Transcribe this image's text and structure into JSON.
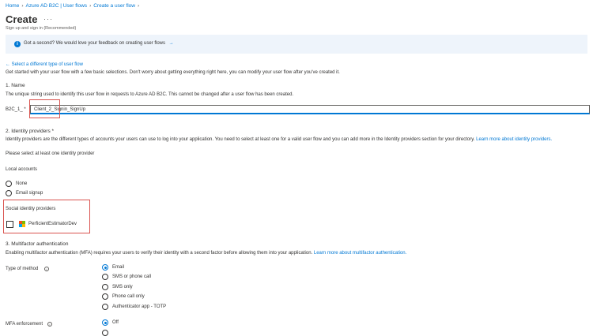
{
  "breadcrumb": [
    "Home",
    "Azure AD B2C | User flows",
    "Create a user flow"
  ],
  "page": {
    "title": "Create",
    "subtitle": "Sign up and sign in (Recommended)"
  },
  "feedback": {
    "text": "Got a second? We would love your feedback on creating user flows",
    "arrow": "→"
  },
  "back_link": "Select a different type of user flow",
  "intro": "Get started with your user flow with a few basic selections. Don't worry about getting everything right here, you can modify your user flow after you've created it.",
  "name_section": {
    "heading": "1. Name",
    "description": "The unique string used to identify this user flow in requests to Azure AD B2C. This cannot be changed after a user flow has been created.",
    "prefix_label": "B2C_1_ *",
    "value": "Client_2_Signin_SignUp"
  },
  "identity_section": {
    "heading": "2. Identity providers *",
    "description": "Identity providers are the different types of accounts your users can use to log into your application. You need to select at least one for a valid user flow and you can add more in the Identity providers section for your directory.",
    "learn_more": "Learn more about identity providers.",
    "instruction": "Please select at least one identity provider",
    "local_accounts_label": "Local accounts",
    "local_options": [
      "None",
      "Email signup"
    ],
    "social_label": "Social identity providers",
    "social_provider": "PerficientEstimatorDev"
  },
  "mfa_section": {
    "heading": "3. Multifactor authentication",
    "description": "Enabling multifactor authentication (MFA) requires your users to verify their identity with a second factor before allowing them into your application.",
    "learn_more": "Learn more about multifactor authentication.",
    "type_label": "Type of method",
    "type_options": [
      "Email",
      "SMS or phone call",
      "SMS only",
      "Phone call only",
      "Authenticator app - TOTP"
    ],
    "enforcement_label": "MFA enforcement",
    "enforcement_options": [
      "Off"
    ]
  },
  "colors": {
    "accent": "#0078d4",
    "highlight": "#d9534f",
    "feedback_bg": "#eef4fb"
  }
}
